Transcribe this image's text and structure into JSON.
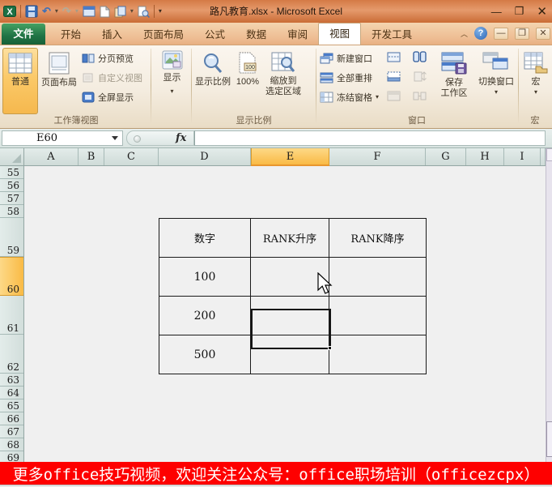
{
  "title_bar": {
    "title": "路凡教育.xlsx - Microsoft Excel"
  },
  "icons": {
    "undo": "↶",
    "redo": "↷",
    "dropdown": "▾",
    "collapse": "︿",
    "help": "?",
    "minimize": "—",
    "restore": "❐",
    "close": "✕",
    "qat_more": "▾",
    "excel_logo": "X"
  },
  "tabs": {
    "file": "文件",
    "items": [
      "开始",
      "插入",
      "页面布局",
      "公式",
      "数据",
      "审阅",
      "视图",
      "开发工具"
    ],
    "selected": "视图"
  },
  "ribbon": {
    "workbook_views": {
      "group_label": "工作簿视图",
      "normal": "普通",
      "page_layout": "页面布局",
      "page_break_preview": "分页预览",
      "custom_views": "自定义视图",
      "full_screen": "全屏显示"
    },
    "show": {
      "label": "显示"
    },
    "zoom": {
      "group_label": "显示比例",
      "zoom": "显示比例",
      "hundred": "100%",
      "to_selection_line1": "缩放到",
      "to_selection_line2": "选定区域"
    },
    "window": {
      "group_label": "窗口",
      "new_window": "新建窗口",
      "arrange_all": "全部重排",
      "freeze_panes": "冻结窗格",
      "save_workspace_line1": "保存",
      "save_workspace_line2": "工作区",
      "switch_windows": "切换窗口"
    },
    "macros": {
      "group_label": "宏",
      "macros": "宏"
    }
  },
  "formula_bar": {
    "name_box": "E60",
    "fx": "fx",
    "formula": ""
  },
  "sheet": {
    "columns": [
      "A",
      "B",
      "C",
      "D",
      "E",
      "F",
      "G",
      "H",
      "I"
    ],
    "rows": [
      "55",
      "56",
      "57",
      "58",
      "59",
      "60",
      "61",
      "62",
      "63",
      "64",
      "65",
      "66",
      "67",
      "68",
      "69"
    ],
    "selected_cell": "E60",
    "selected_column": "E",
    "selected_row": "60",
    "table": {
      "headers": [
        "数字",
        "RANK升序",
        "RANK降序"
      ],
      "rows": [
        [
          "100",
          "",
          ""
        ],
        [
          "200",
          "",
          ""
        ],
        [
          "500",
          "",
          ""
        ]
      ]
    }
  },
  "banner": {
    "text": "更多office技巧视频，欢迎关注公众号：office职场培训（officezcpx）"
  },
  "colors": {
    "banner_bg": "#fe0000",
    "banner_fg": "#ffffff",
    "selection_header": "#f9ba45",
    "file_tab_green": "#1f7345",
    "title_bar_orange": "#d47a46"
  }
}
